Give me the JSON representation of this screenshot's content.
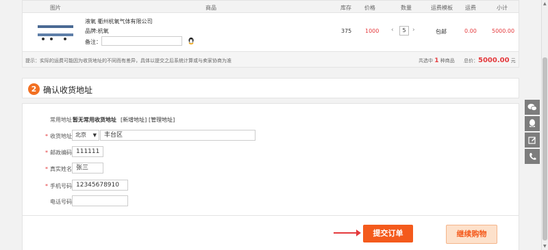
{
  "table": {
    "headers": [
      "图片",
      "商品",
      "库存",
      "价格",
      "数量",
      "运费模板",
      "运费",
      "小计"
    ],
    "row": {
      "name": "液氧 衢州杭氧气体有限公司",
      "brand": "品牌:杭氧",
      "remark_label": "备注：",
      "remark_value": "",
      "stock": "375",
      "price": "1000",
      "quantity": "5",
      "freight_template": "包邮",
      "freight": "0.00",
      "subtotal": "5000.00"
    }
  },
  "tip": {
    "text": "提示：实际的运费可能因为收货地址的不同而有差异，具体以提交之后系统计算或与卖家协商为准",
    "selected_prefix": "共选中",
    "selected_count": "1",
    "selected_suffix": "种商品",
    "total_label": "总价：",
    "total_value": "5000.00",
    "total_unit": "元"
  },
  "section": {
    "step": "2",
    "title": "确认收货地址"
  },
  "address": {
    "common_label": "常用地址：",
    "common_value": "暂无常用收货地址",
    "new_link": "[新增地址]",
    "manage_link": "[管理地址]",
    "recv_label": "收货地址：",
    "province": "北京",
    "district": "丰台区",
    "zip_label": "邮政编码：",
    "zip": "111111",
    "name_label": "真实姓名：",
    "name": "张三",
    "mobile_label": "手机号码：",
    "mobile": "12345678910",
    "phone_label": "电话号码：",
    "phone": "",
    "required_mark": "*"
  },
  "actions": {
    "submit": "提交订单",
    "continue": "继续购物"
  },
  "float_bar": [
    "wechat-icon",
    "qq-icon",
    "edit-icon",
    "phone-icon"
  ],
  "colors": {
    "accent": "#f45a1c",
    "price": "#e4393c",
    "badge": "#f27022"
  }
}
